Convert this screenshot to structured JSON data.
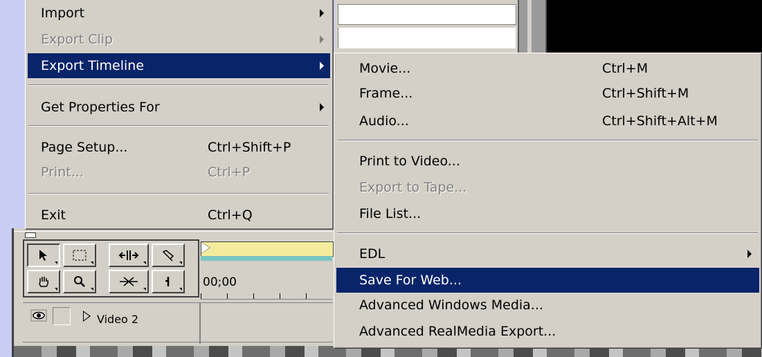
{
  "file_menu": {
    "items": [
      {
        "label": "Import",
        "shortcut": "",
        "submenu": true,
        "disabled": false
      },
      {
        "label": "Export Clip",
        "shortcut": "",
        "submenu": true,
        "disabled": true
      },
      {
        "label": "Export Timeline",
        "shortcut": "",
        "submenu": true,
        "disabled": false,
        "highlighted": true
      },
      {
        "label": "Get Properties For",
        "shortcut": "",
        "submenu": true,
        "disabled": false
      },
      {
        "label": "Page Setup...",
        "shortcut": "Ctrl+Shift+P",
        "submenu": false,
        "disabled": false
      },
      {
        "label": "Print...",
        "shortcut": "Ctrl+P",
        "submenu": false,
        "disabled": true
      },
      {
        "label": "Exit",
        "shortcut": "Ctrl+Q",
        "submenu": false,
        "disabled": false
      }
    ]
  },
  "export_timeline_submenu": {
    "items": [
      {
        "label": "Movie...",
        "shortcut": "Ctrl+M"
      },
      {
        "label": "Frame...",
        "shortcut": "Ctrl+Shift+M"
      },
      {
        "label": "Audio...",
        "shortcut": "Ctrl+Shift+Alt+M"
      },
      {
        "label": "Print to Video...",
        "shortcut": ""
      },
      {
        "label": "Export to Tape...",
        "shortcut": "",
        "disabled": true
      },
      {
        "label": "File List...",
        "shortcut": ""
      },
      {
        "label": "EDL",
        "shortcut": "",
        "submenu": true
      },
      {
        "label": "Save For Web...",
        "shortcut": "",
        "highlighted": true
      },
      {
        "label": "Advanced Windows Media...",
        "shortcut": ""
      },
      {
        "label": "Advanced RealMedia Export...",
        "shortcut": ""
      }
    ]
  },
  "timeline": {
    "timecode": "00;00",
    "track_label": "Video 2",
    "tools": [
      "selection-tool-icon",
      "range-select-tool-icon",
      "ripple-edit-tool-icon",
      "razor-tool-icon",
      "hand-tool-icon",
      "zoom-tool-icon",
      "cross-fade-tool-icon",
      "in-out-point-tool-icon"
    ]
  },
  "colors": {
    "highlight": "#0a246a",
    "menu_face": "#d4d0c8",
    "desktop": "#c9cdf3",
    "disabled_text": "#808080"
  }
}
